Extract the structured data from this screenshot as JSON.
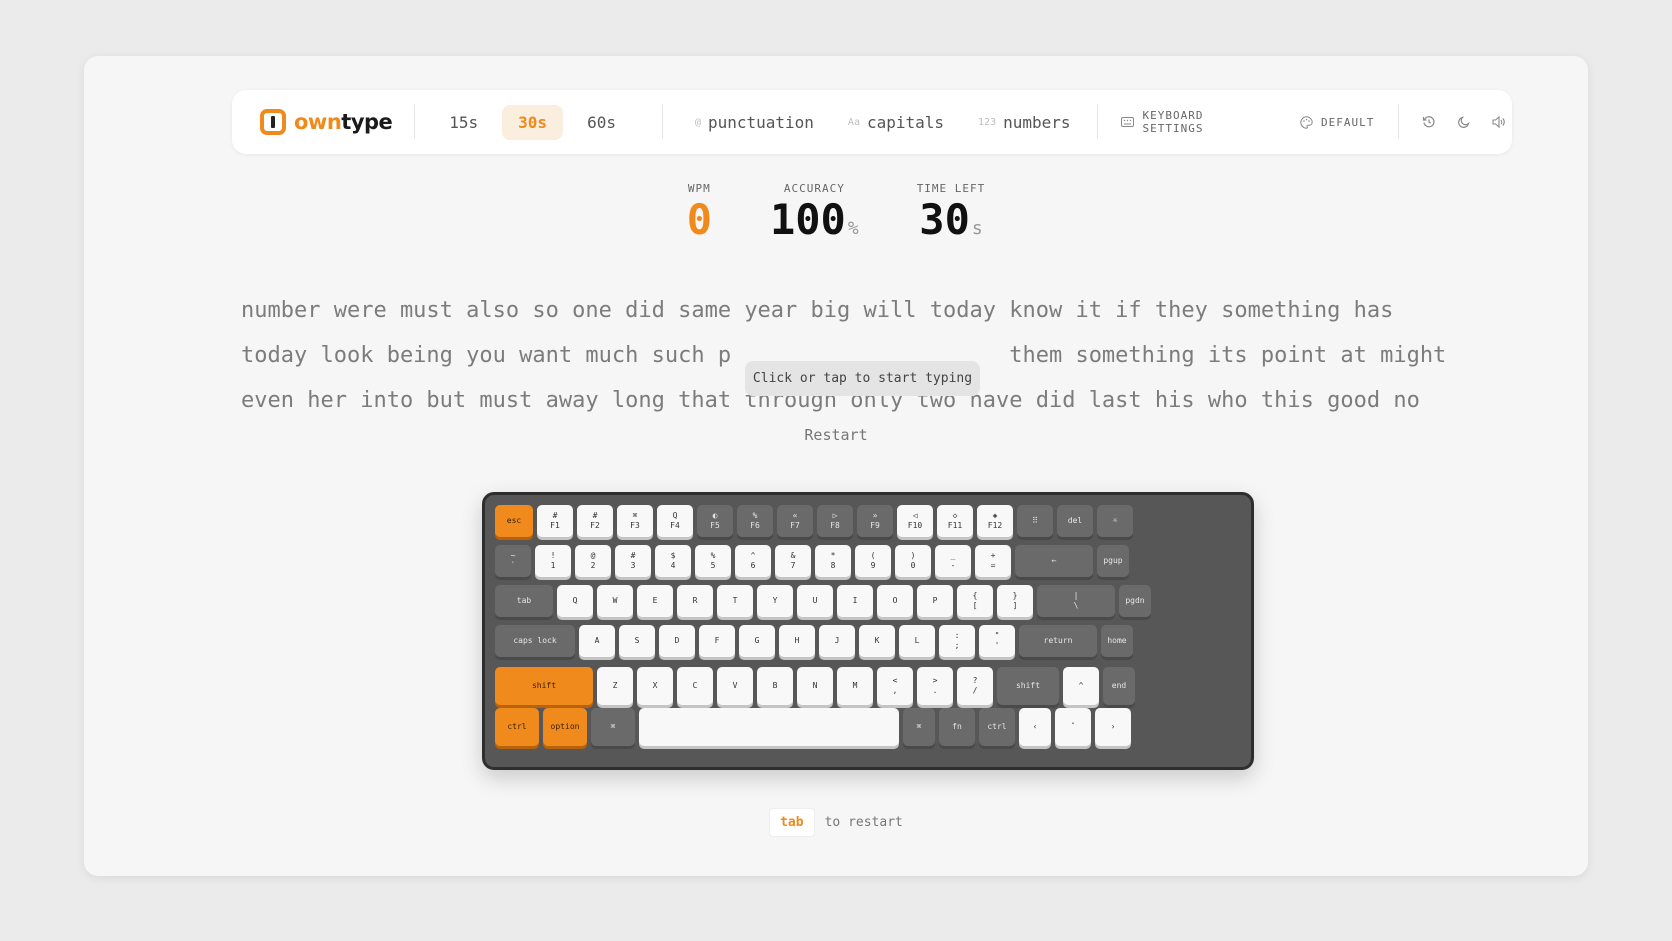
{
  "brand": {
    "own": "own",
    "type": "type"
  },
  "durations": [
    {
      "label": "15s",
      "active": false
    },
    {
      "label": "30s",
      "active": true
    },
    {
      "label": "60s",
      "active": false
    }
  ],
  "options": [
    {
      "prefix": "@",
      "label": "punctuation",
      "icon": "at-sign-icon"
    },
    {
      "prefix": "Aa",
      "label": "capitals",
      "icon": "case-icon"
    },
    {
      "prefix": "123",
      "label": "numbers",
      "icon": "numbers-icon"
    }
  ],
  "settings": {
    "keyboard": "KEYBOARD SETTINGS",
    "theme": "DEFAULT"
  },
  "stats": {
    "wpm": {
      "label": "WPM",
      "value": "0",
      "color": "#f08a1c"
    },
    "accuracy": {
      "label": "ACCURACY",
      "value": "100",
      "unit": "%"
    },
    "time": {
      "label": "TIME LEFT",
      "value": "30",
      "unit": "s"
    }
  },
  "words": {
    "line1": "number were must also so one did same year big will today know it if they something has",
    "line2": "today look being you want much such p                     them something its point at might",
    "line3": "even her into but must away long that through only two have did last his who this good no"
  },
  "tooltip": "Click or tap to start typing",
  "restart": "Restart",
  "hint": {
    "key": "tab",
    "text": "to restart"
  },
  "accent": "#f08a1c",
  "keyboard": {
    "rows": [
      [
        {
          "t": "",
          "b": "esc",
          "c": "o"
        },
        {
          "t": "#",
          "b": "F1",
          "c": "w"
        },
        {
          "t": "#",
          "b": "F2",
          "c": "w"
        },
        {
          "t": "⌘",
          "b": "F3",
          "c": "w"
        },
        {
          "t": "Q",
          "b": "F4",
          "c": "w"
        },
        {
          "t": "◐",
          "b": "F5",
          "c": "d"
        },
        {
          "t": "%",
          "b": "F6",
          "c": "d"
        },
        {
          "t": "«",
          "b": "F7",
          "c": "d"
        },
        {
          "t": "▷",
          "b": "F8",
          "c": "d"
        },
        {
          "t": "»",
          "b": "F9",
          "c": "d"
        },
        {
          "t": "◁",
          "b": "F10",
          "c": "w"
        },
        {
          "t": "◇",
          "b": "F11",
          "c": "w"
        },
        {
          "t": "◈",
          "b": "F12",
          "c": "w"
        },
        {
          "t": "",
          "b": "⠿",
          "c": "d"
        },
        {
          "t": "",
          "b": "del",
          "c": "d"
        },
        {
          "t": "",
          "b": "☼",
          "c": "d"
        }
      ],
      [
        {
          "t": "~",
          "b": "`",
          "c": "d"
        },
        {
          "t": "!",
          "b": "1",
          "c": "w"
        },
        {
          "t": "@",
          "b": "2",
          "c": "w"
        },
        {
          "t": "#",
          "b": "3",
          "c": "w"
        },
        {
          "t": "$",
          "b": "4",
          "c": "w"
        },
        {
          "t": "%",
          "b": "5",
          "c": "w"
        },
        {
          "t": "^",
          "b": "6",
          "c": "w"
        },
        {
          "t": "&",
          "b": "7",
          "c": "w"
        },
        {
          "t": "*",
          "b": "8",
          "c": "w"
        },
        {
          "t": "(",
          "b": "9",
          "c": "w"
        },
        {
          "t": ")",
          "b": "0",
          "c": "w"
        },
        {
          "t": "_",
          "b": "-",
          "c": "w"
        },
        {
          "t": "+",
          "b": "=",
          "c": "w"
        },
        {
          "t": "",
          "b": "←",
          "c": "d"
        },
        {
          "t": "",
          "b": "pgup",
          "c": "d"
        }
      ],
      [
        {
          "t": "",
          "b": "tab",
          "c": "d"
        },
        {
          "t": "",
          "b": "Q",
          "c": "w"
        },
        {
          "t": "",
          "b": "W",
          "c": "w"
        },
        {
          "t": "",
          "b": "E",
          "c": "w"
        },
        {
          "t": "",
          "b": "R",
          "c": "w"
        },
        {
          "t": "",
          "b": "T",
          "c": "w"
        },
        {
          "t": "",
          "b": "Y",
          "c": "w"
        },
        {
          "t": "",
          "b": "U",
          "c": "w"
        },
        {
          "t": "",
          "b": "I",
          "c": "w"
        },
        {
          "t": "",
          "b": "O",
          "c": "w"
        },
        {
          "t": "",
          "b": "P",
          "c": "w"
        },
        {
          "t": "{",
          "b": "[",
          "c": "w"
        },
        {
          "t": "}",
          "b": "]",
          "c": "w"
        },
        {
          "t": "|",
          "b": "\\",
          "c": "d"
        },
        {
          "t": "",
          "b": "pgdn",
          "c": "d"
        }
      ],
      [
        {
          "t": "",
          "b": "caps lock",
          "c": "d"
        },
        {
          "t": "",
          "b": "A",
          "c": "w"
        },
        {
          "t": "",
          "b": "S",
          "c": "w"
        },
        {
          "t": "",
          "b": "D",
          "c": "w"
        },
        {
          "t": "",
          "b": "F",
          "c": "w"
        },
        {
          "t": "",
          "b": "G",
          "c": "w"
        },
        {
          "t": "",
          "b": "H",
          "c": "w"
        },
        {
          "t": "",
          "b": "J",
          "c": "w"
        },
        {
          "t": "",
          "b": "K",
          "c": "w"
        },
        {
          "t": "",
          "b": "L",
          "c": "w"
        },
        {
          "t": ":",
          "b": ";",
          "c": "w"
        },
        {
          "t": "\"",
          "b": "'",
          "c": "w"
        },
        {
          "t": "",
          "b": "return",
          "c": "d"
        },
        {
          "t": "",
          "b": "home",
          "c": "d"
        }
      ],
      [
        {
          "t": "",
          "b": "shift",
          "c": "o"
        },
        {
          "t": "",
          "b": "Z",
          "c": "w"
        },
        {
          "t": "",
          "b": "X",
          "c": "w"
        },
        {
          "t": "",
          "b": "C",
          "c": "w"
        },
        {
          "t": "",
          "b": "V",
          "c": "w"
        },
        {
          "t": "",
          "b": "B",
          "c": "w"
        },
        {
          "t": "",
          "b": "N",
          "c": "w"
        },
        {
          "t": "",
          "b": "M",
          "c": "w"
        },
        {
          "t": "<",
          "b": ",",
          "c": "w"
        },
        {
          "t": ">",
          "b": ".",
          "c": "w"
        },
        {
          "t": "?",
          "b": "/",
          "c": "w"
        },
        {
          "t": "",
          "b": "shift",
          "c": "d"
        },
        {
          "t": "",
          "b": "^",
          "c": "w"
        },
        {
          "t": "",
          "b": "end",
          "c": "d"
        }
      ],
      [
        {
          "t": "",
          "b": "ctrl",
          "c": "o"
        },
        {
          "t": "",
          "b": "option",
          "c": "o"
        },
        {
          "t": "",
          "b": "⌘",
          "c": "d"
        },
        {
          "t": "",
          "b": "",
          "c": "w"
        },
        {
          "t": "",
          "b": "⌘",
          "c": "d"
        },
        {
          "t": "",
          "b": "fn",
          "c": "d"
        },
        {
          "t": "",
          "b": "ctrl",
          "c": "d"
        },
        {
          "t": "",
          "b": "‹",
          "c": "w"
        },
        {
          "t": "",
          "b": "ˇ",
          "c": "w"
        },
        {
          "t": "",
          "b": "›",
          "c": "w"
        }
      ]
    ]
  }
}
